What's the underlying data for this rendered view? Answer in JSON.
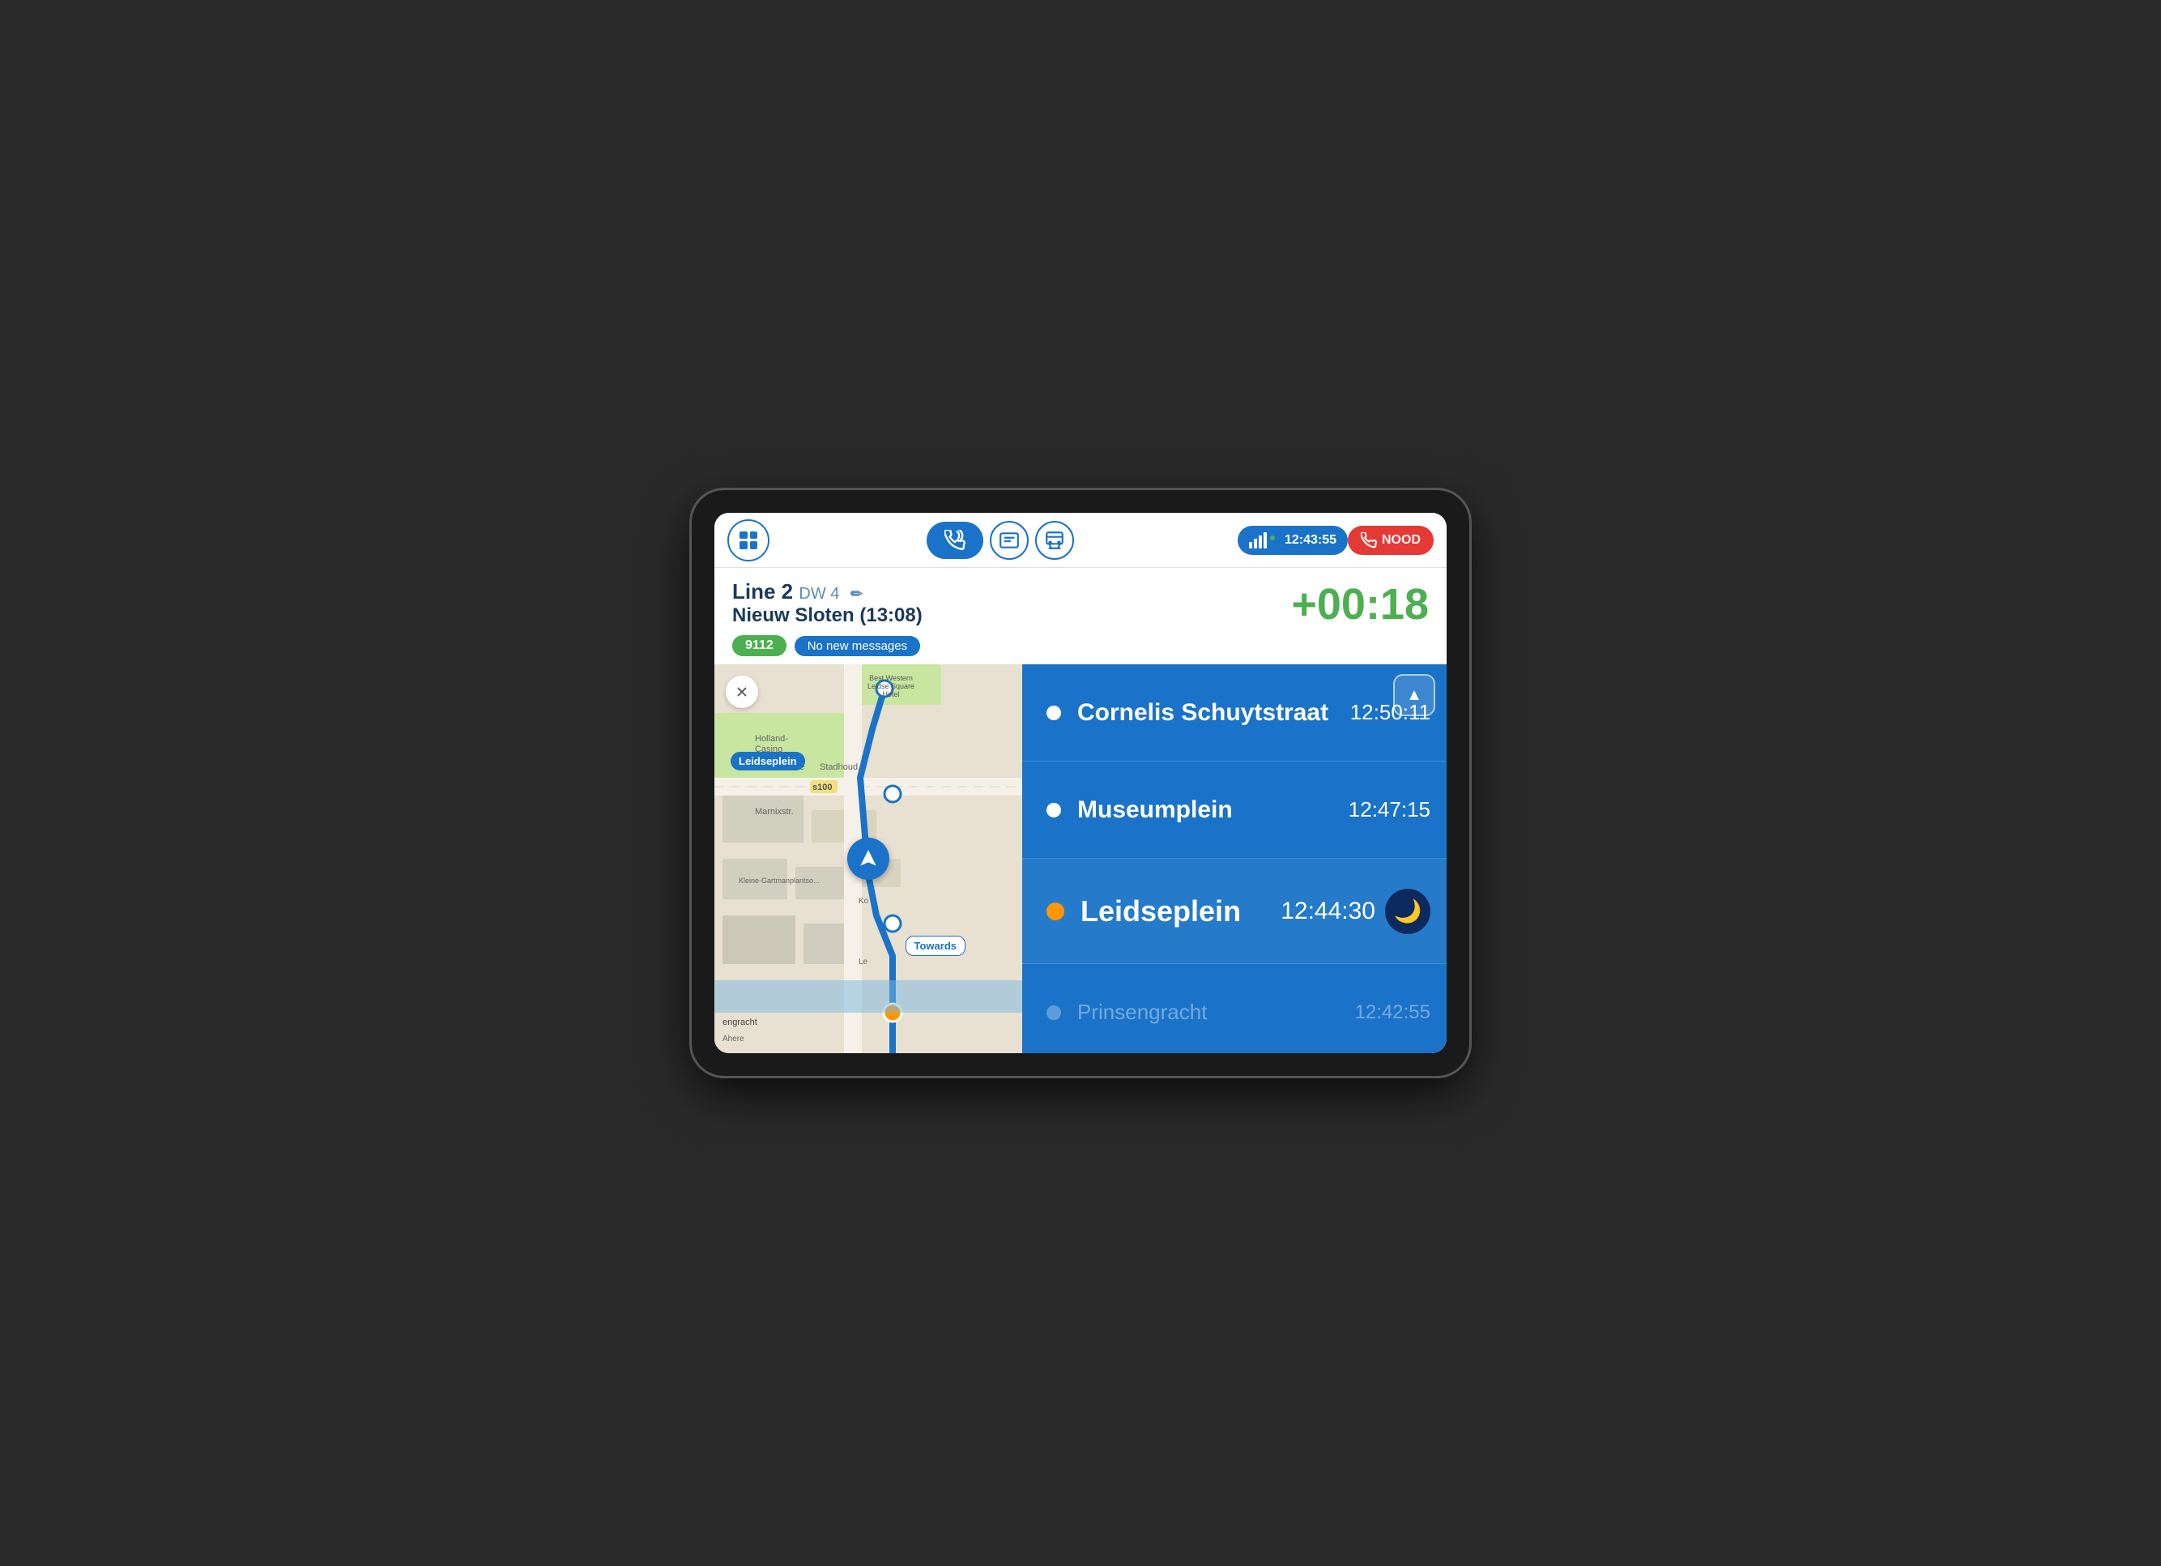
{
  "device": {
    "frame_color": "#1a1a1a"
  },
  "nav": {
    "grid_btn_label": "Grid menu",
    "call_btn_label": "Call",
    "messages_btn_label": "Messages",
    "transit_btn_label": "Transit",
    "signal_label": "Signal bars",
    "clock": "12:43:55",
    "nood_label": "NOOD"
  },
  "info": {
    "line_number": "Line 2",
    "dw_label": "DW 4",
    "destination": "Nieuw Sloten (13:08)",
    "timer": "+00:18",
    "vehicle_id": "9112",
    "messages_badge": "No new messages"
  },
  "map": {
    "close_label": "×",
    "leidseplein_label": "Leidseplein",
    "towards_label": "Towards"
  },
  "stops": [
    {
      "name": "Cornelis Schuytstraat",
      "time": "12:50:11",
      "type": "future",
      "dot": "white"
    },
    {
      "name": "Museumplein",
      "time": "12:47:15",
      "type": "future",
      "dot": "white"
    },
    {
      "name": "Leidseplein",
      "time": "12:44:30",
      "type": "current",
      "dot": "orange"
    },
    {
      "name": "Prinsengracht",
      "time": "12:42:55",
      "type": "past",
      "dot": "past"
    }
  ],
  "scroll_up_label": "▲",
  "moon_label": "🌙"
}
